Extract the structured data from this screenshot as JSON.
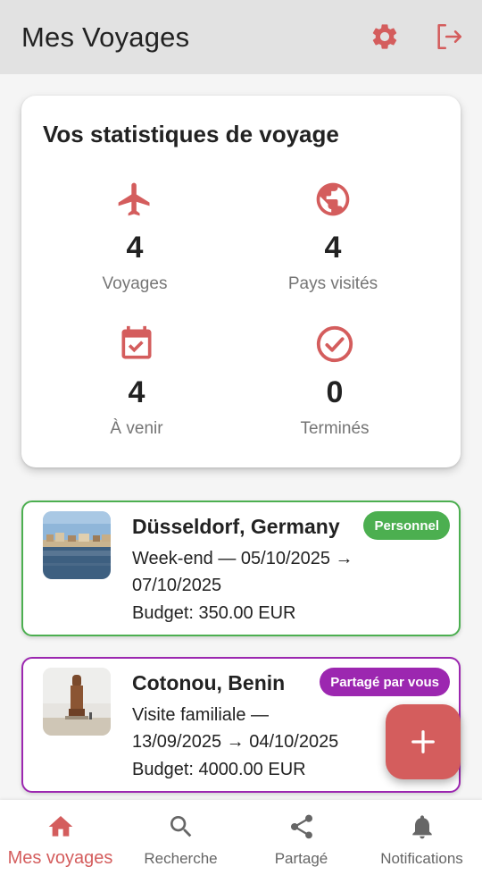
{
  "header": {
    "title": "Mes Voyages",
    "settings_icon": "gear-icon",
    "logout_icon": "logout-icon"
  },
  "colors": {
    "accent": "#d45d5d",
    "green": "#4caf50",
    "purple": "#9c27b0"
  },
  "stats": {
    "heading": "Vos statistiques de voyage",
    "items": [
      {
        "icon": "airplane-icon",
        "value": "4",
        "label": "Voyages"
      },
      {
        "icon": "globe-icon",
        "value": "4",
        "label": "Pays visités"
      },
      {
        "icon": "calendar-check-icon",
        "value": "4",
        "label": "À venir"
      },
      {
        "icon": "check-circle-icon",
        "value": "0",
        "label": "Terminés"
      }
    ]
  },
  "trips": [
    {
      "title": "Düsseldorf, Germany",
      "line1": "Week-end — 05/10/2025 →",
      "line2": "07/10/2025",
      "budget": "Budget: 350.00 EUR",
      "badge": "Personnel"
    },
    {
      "title": "Cotonou, Benin",
      "line1": "Visite familiale —",
      "line2": "13/09/2025 → 04/10/2025",
      "budget": "Budget: 4000.00 EUR",
      "badge": "Partagé par vous"
    }
  ],
  "fab": {
    "icon": "plus-icon"
  },
  "nav": [
    {
      "label": "Mes voyages",
      "icon": "home-icon"
    },
    {
      "label": "Recherche",
      "icon": "search-icon"
    },
    {
      "label": "Partagé",
      "icon": "share-icon"
    },
    {
      "label": "Notifications",
      "icon": "bell-icon"
    }
  ]
}
